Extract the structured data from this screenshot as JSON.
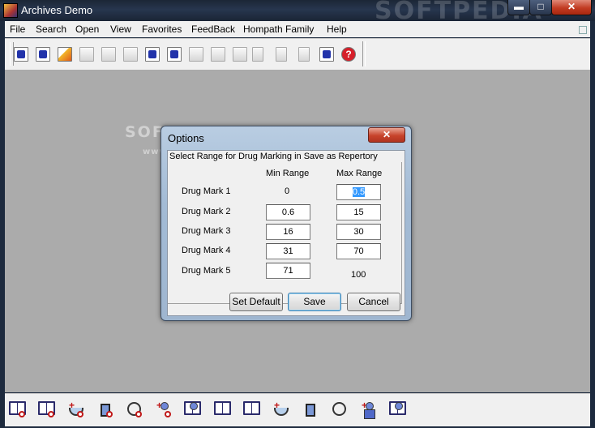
{
  "window": {
    "title": "Archives Demo",
    "watermark": "SOFTPEDIA",
    "minimize_glyph": "▬",
    "maximize_glyph": "□",
    "close_glyph": "✕"
  },
  "menu": {
    "items": [
      "File",
      "Search",
      "Open",
      "View",
      "Favorites",
      "FeedBack",
      "Hompath Family",
      "Help"
    ]
  },
  "toolbar": {
    "help_glyph": "?"
  },
  "client": {
    "watermark_large": "SOFTPEDIA",
    "watermark_small": "www.softpedia.com"
  },
  "dialog": {
    "title": "Options",
    "close_glyph": "✕",
    "caption": "Select Range for Drug Marking in Save as Repertory",
    "min_header": "Min Range",
    "max_header": "Max Range",
    "rows": [
      {
        "label": "Drug Mark 1",
        "min": "0",
        "max": "0.5"
      },
      {
        "label": "Drug Mark 2",
        "min": "0.6",
        "max": "15"
      },
      {
        "label": "Drug Mark 3",
        "min": "16",
        "max": "30"
      },
      {
        "label": "Drug Mark 4",
        "min": "31",
        "max": "70"
      },
      {
        "label": "Drug Mark 5",
        "min": "71",
        "max": "100"
      }
    ],
    "buttons": {
      "set_default": "Set Default",
      "save": "Save",
      "cancel": "Cancel"
    }
  },
  "colors": {
    "titlebar": "#1b2636",
    "client_bg": "#ababab",
    "dialog_frame": "#a3bbd5",
    "close_red": "#c7432b",
    "selection": "#3399ff"
  }
}
